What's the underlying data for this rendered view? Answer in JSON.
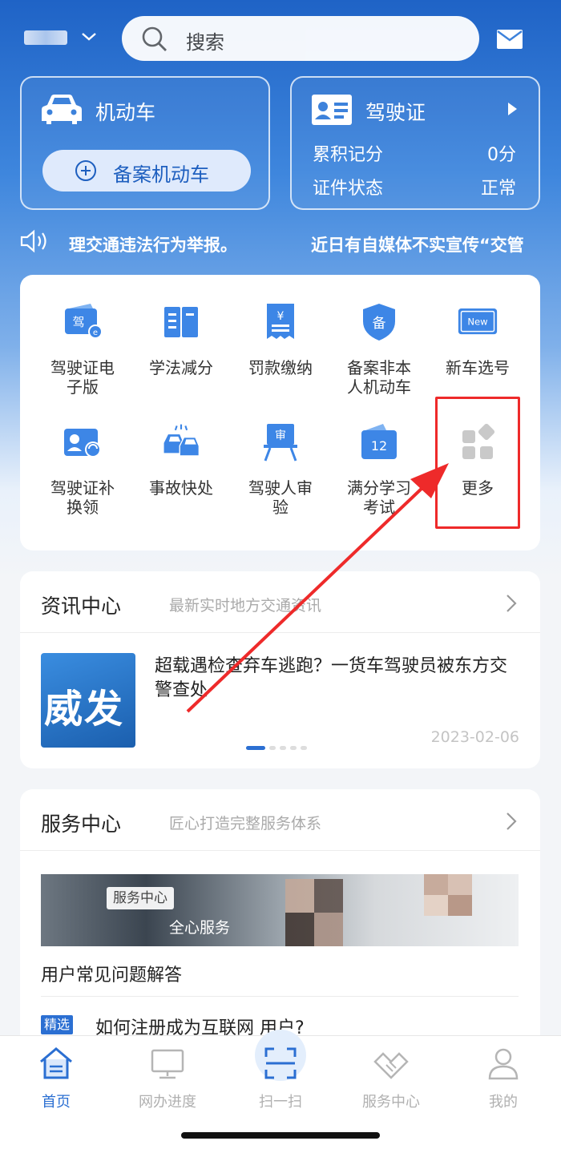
{
  "header": {
    "search_placeholder": "搜索"
  },
  "motor_card": {
    "title": "机动车",
    "register_button": "备案机动车"
  },
  "license_card": {
    "title": "驾驶证",
    "rows": [
      {
        "label": "累积记分",
        "value": "0分"
      },
      {
        "label": "证件状态",
        "value": "正常"
      }
    ]
  },
  "notice": {
    "text_left": "理交通违法行为举报。",
    "text_right": "近日有自媒体不实宣传“交管"
  },
  "services": [
    {
      "label": "驾驶证电子版",
      "icon": "e-license-icon"
    },
    {
      "label": "学法减分",
      "icon": "book-icon"
    },
    {
      "label": "罚款缴纳",
      "icon": "fine-receipt-icon"
    },
    {
      "label": "备案非本人机动车",
      "icon": "shield-record-icon"
    },
    {
      "label": "新车选号",
      "icon": "new-plate-icon"
    },
    {
      "label": "驾驶证补换领",
      "icon": "license-renew-icon"
    },
    {
      "label": "事故快处",
      "icon": "accident-icon"
    },
    {
      "label": "驾驶人审验",
      "icon": "driver-review-icon"
    },
    {
      "label": "满分学习考试",
      "icon": "calendar-12-icon"
    },
    {
      "label": "更多",
      "icon": "more-grid-icon"
    }
  ],
  "news": {
    "title": "资讯中心",
    "subtitle": "最新实时地方交通资讯",
    "thumb_text": "威发",
    "headline": "超载遇检查弃车逃跑？一货车驾驶员被东方交警查处",
    "date": "2023-02-06"
  },
  "service_center": {
    "title": "服务中心",
    "subtitle": "匠心打造完整服务体系",
    "banner_tag": "服务中心",
    "banner_slogan": "全心服务",
    "faq_title": "用户常见问题解答",
    "badge": "精选",
    "faq_item": "如何注册成为互联网 用户?"
  },
  "tabs": [
    {
      "label": "首页",
      "icon": "home-icon"
    },
    {
      "label": "网办进度",
      "icon": "monitor-icon"
    },
    {
      "label": "扫一扫",
      "icon": "scan-icon"
    },
    {
      "label": "服务中心",
      "icon": "handshake-icon"
    },
    {
      "label": "我的",
      "icon": "user-icon"
    }
  ],
  "colors": {
    "brand_blue": "#2b6fd2",
    "highlight_red": "#ee2a2a"
  }
}
